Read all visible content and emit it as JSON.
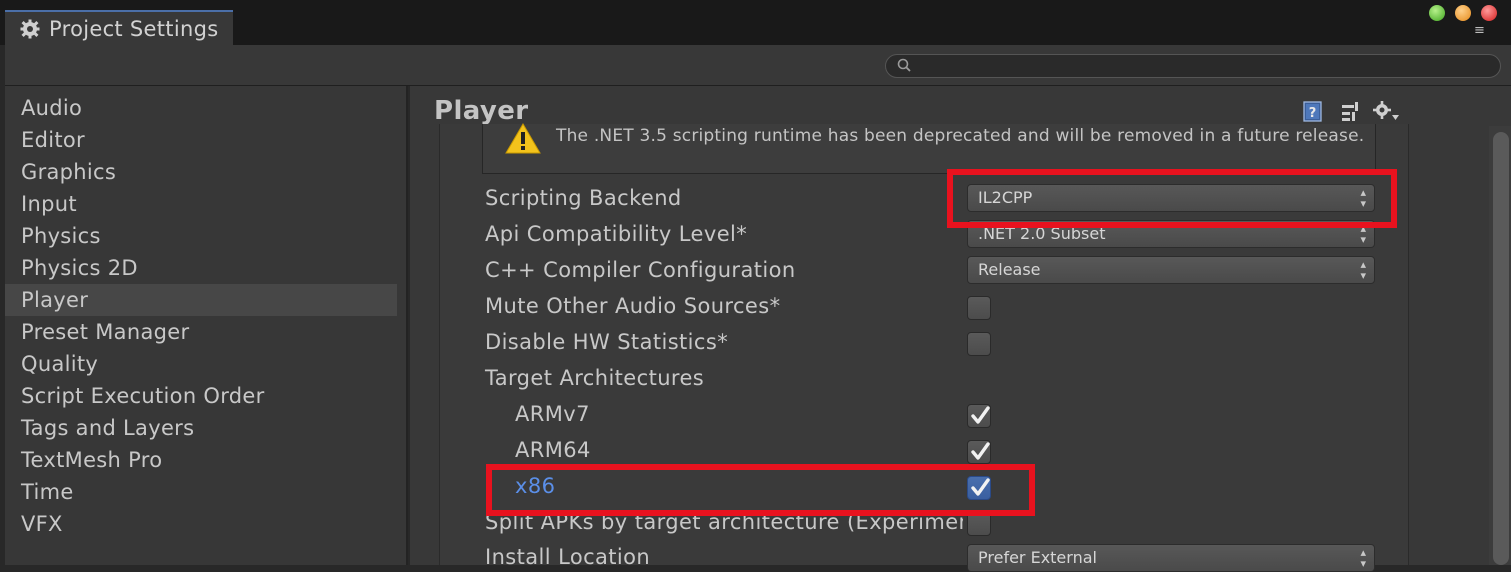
{
  "window": {
    "title": "Project Settings",
    "controls": [
      "green",
      "orange",
      "red"
    ],
    "menu_icon": "≡"
  },
  "search": {
    "placeholder": ""
  },
  "sidebar": {
    "items": [
      {
        "label": "Audio"
      },
      {
        "label": "Editor"
      },
      {
        "label": "Graphics"
      },
      {
        "label": "Input"
      },
      {
        "label": "Physics"
      },
      {
        "label": "Physics 2D"
      },
      {
        "label": "Player",
        "selected": true
      },
      {
        "label": "Preset Manager"
      },
      {
        "label": "Quality"
      },
      {
        "label": "Script Execution Order"
      },
      {
        "label": "Tags and Layers"
      },
      {
        "label": "TextMesh Pro"
      },
      {
        "label": "Time"
      },
      {
        "label": "VFX"
      }
    ]
  },
  "main": {
    "title": "Player",
    "header_icons": [
      "help-icon",
      "preset-icon",
      "gear-icon"
    ],
    "warning": {
      "icon": "warning-icon",
      "text": "The .NET 3.5 scripting runtime has been deprecated and will be removed in a future release."
    },
    "settings": {
      "scripting_backend": {
        "label": "Scripting Backend",
        "value": "IL2CPP"
      },
      "api_compat": {
        "label": "Api Compatibility Level*",
        "value": ".NET 2.0 Subset"
      },
      "cpp_config": {
        "label": "C++ Compiler Configuration",
        "value": "Release"
      },
      "mute_audio": {
        "label": "Mute Other Audio Sources*",
        "checked": false
      },
      "disable_hw": {
        "label": "Disable HW Statistics*",
        "checked": false
      },
      "target_arch": {
        "label": "Target Architectures"
      },
      "armv7": {
        "label": "ARMv7",
        "checked": true
      },
      "arm64": {
        "label": "ARM64",
        "checked": true
      },
      "x86": {
        "label": "x86",
        "checked": true
      },
      "split_apks": {
        "label": "Split APKs by target architecture (Experiment",
        "checked": false
      },
      "install_location": {
        "label": "Install Location",
        "value": "Prefer External"
      }
    }
  },
  "colors": {
    "highlight": "#e8121e",
    "focus_blue": "#5b8fe8",
    "background": "#383838"
  }
}
